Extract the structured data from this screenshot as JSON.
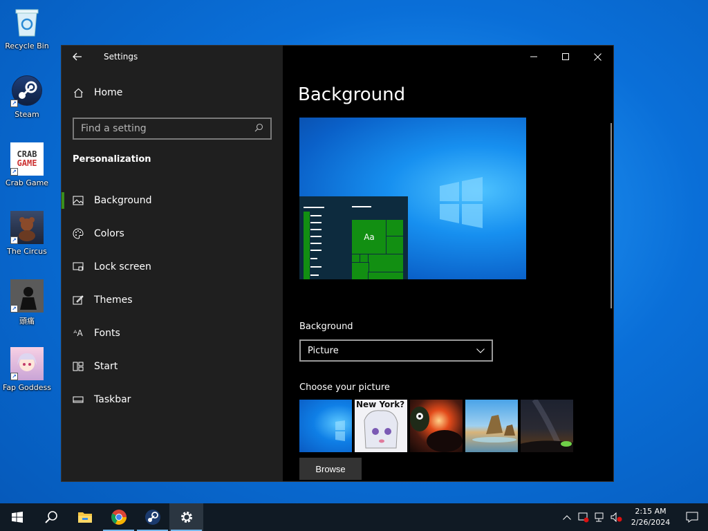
{
  "desktop": {
    "icons": [
      {
        "label": "Recycle Bin"
      },
      {
        "label": "Steam"
      },
      {
        "label": "Crab Game"
      },
      {
        "label": "The Circus"
      },
      {
        "label": "頭痛"
      },
      {
        "label": "Fap Goddess"
      }
    ],
    "crab_logo_line1": "CRAB",
    "crab_logo_line2": "GAME"
  },
  "window": {
    "title": "Settings",
    "home_label": "Home",
    "search_placeholder": "Find a setting",
    "section_title": "Personalization",
    "nav": [
      {
        "label": "Background",
        "icon": "image-icon",
        "active": true
      },
      {
        "label": "Colors",
        "icon": "palette-icon"
      },
      {
        "label": "Lock screen",
        "icon": "lock-screen-icon"
      },
      {
        "label": "Themes",
        "icon": "themes-icon"
      },
      {
        "label": "Fonts",
        "icon": "fonts-icon"
      },
      {
        "label": "Start",
        "icon": "start-icon"
      },
      {
        "label": "Taskbar",
        "icon": "taskbar-icon"
      }
    ],
    "accent_color": "#3b8e1d"
  },
  "content": {
    "page_title": "Background",
    "preview_tile_text": "Aa",
    "background_label": "Background",
    "background_value": "Picture",
    "choose_label": "Choose your picture",
    "thumb_text_1": "New York?",
    "browse_label": "Browse"
  },
  "taskbar": {
    "apps": [
      "start-icon",
      "search-icon",
      "file-explorer-icon",
      "chrome-icon",
      "steam-icon",
      "settings-icon"
    ],
    "time": "2:15 AM",
    "date": "2/26/2024"
  }
}
